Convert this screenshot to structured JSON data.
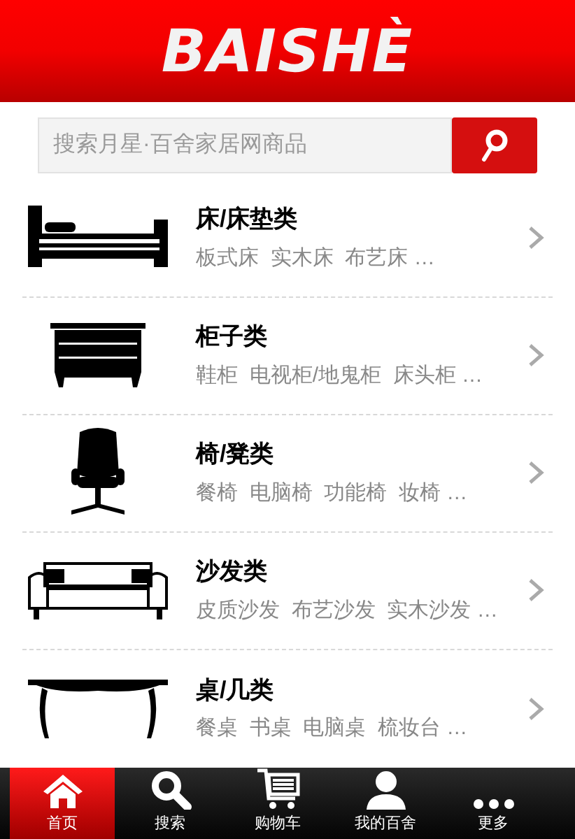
{
  "header": {
    "logo": "BAISHÈ"
  },
  "search": {
    "placeholder": "搜索月星·百舍家居网商品"
  },
  "categories": [
    {
      "kind": "bed",
      "title": "床/床垫类",
      "items": "板式床  实木床  布艺床 …"
    },
    {
      "kind": "cabinet",
      "title": "柜子类",
      "items": "鞋柜  电视柜/地鬼柜  床头柜 …"
    },
    {
      "kind": "chair",
      "title": "椅/凳类",
      "items": "餐椅  电脑椅  功能椅  妆椅 …"
    },
    {
      "kind": "sofa",
      "title": "沙发类",
      "items": "皮质沙发  布艺沙发  实木沙发 …"
    },
    {
      "kind": "table",
      "title": "桌/几类",
      "items": "餐桌  书桌  电脑桌  梳妆台 …"
    }
  ],
  "tab_bar": [
    {
      "kind": "home",
      "label": "首页",
      "selected": true
    },
    {
      "kind": "search",
      "label": "搜索",
      "selected": false
    },
    {
      "kind": "cart",
      "label": "购物车",
      "selected": false
    },
    {
      "kind": "user",
      "label": "我的百舍",
      "selected": false
    },
    {
      "kind": "more",
      "label": "更多",
      "selected": false
    }
  ]
}
